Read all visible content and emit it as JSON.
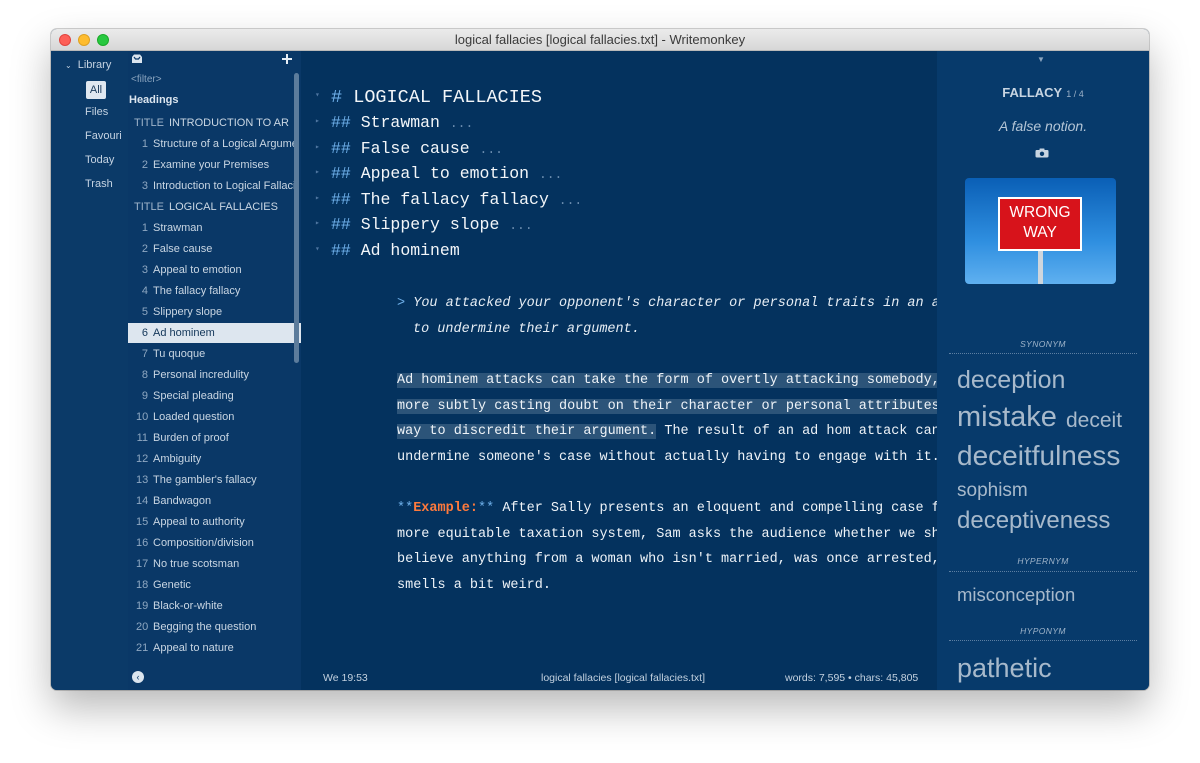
{
  "window": {
    "title": "logical fallacies [logical fallacies.txt] - Writemonkey"
  },
  "library": {
    "header": "Library",
    "items": [
      "All",
      "Files",
      "Favouri",
      "Today",
      "Trash"
    ]
  },
  "navigator": {
    "filter_placeholder": "<filter>",
    "headings_label": "Headings",
    "rows": [
      {
        "num": "TITLE",
        "label": "INTRODUCTION TO AR"
      },
      {
        "num": "1",
        "label": "Structure of a Logical Argume"
      },
      {
        "num": "2",
        "label": "Examine your Premises"
      },
      {
        "num": "3",
        "label": "Introduction to Logical Fallaci"
      },
      {
        "num": "TITLE",
        "label": "LOGICAL FALLACIES"
      },
      {
        "num": "1",
        "label": "Strawman"
      },
      {
        "num": "2",
        "label": "False cause"
      },
      {
        "num": "3",
        "label": "Appeal to emotion"
      },
      {
        "num": "4",
        "label": "The fallacy fallacy"
      },
      {
        "num": "5",
        "label": "Slippery slope"
      },
      {
        "num": "6",
        "label": "Ad hominem"
      },
      {
        "num": "7",
        "label": "Tu quoque"
      },
      {
        "num": "8",
        "label": "Personal incredulity"
      },
      {
        "num": "9",
        "label": "Special pleading"
      },
      {
        "num": "10",
        "label": "Loaded question"
      },
      {
        "num": "11",
        "label": "Burden of proof"
      },
      {
        "num": "12",
        "label": "Ambiguity"
      },
      {
        "num": "13",
        "label": "The gambler's fallacy"
      },
      {
        "num": "14",
        "label": "Bandwagon"
      },
      {
        "num": "15",
        "label": "Appeal to authority"
      },
      {
        "num": "16",
        "label": "Composition/division"
      },
      {
        "num": "17",
        "label": "No true scotsman"
      },
      {
        "num": "18",
        "label": "Genetic"
      },
      {
        "num": "19",
        "label": "Black-or-white"
      },
      {
        "num": "20",
        "label": "Begging the question"
      },
      {
        "num": "21",
        "label": "Appeal to nature"
      }
    ]
  },
  "editor": {
    "h1_hash": "#",
    "h1_text": "LOGICAL FALLACIES",
    "h2_hash": "##",
    "h2_items": [
      "Strawman",
      "False cause",
      "Appeal to emotion",
      "The fallacy fallacy",
      "Slippery slope",
      "Ad hominem"
    ],
    "ellipsis": "...",
    "quote_marker": ">",
    "quote_lines": [
      "You attacked your opponent's character or personal traits in an attempt",
      "to undermine their argument."
    ],
    "para1_highlight": [
      "Ad hominem attacks can take the form of overtly attacking somebody, or",
      "more subtly casting doubt on their character or personal attributes as a",
      "way to discredit their argument."
    ],
    "para1_rest": [
      " The result of an ad hom attack can be to",
      "undermine someone's case without actually having to engage with it."
    ],
    "example_stars": "**",
    "example_label": "Example:",
    "example_lines": [
      " After Sally presents an eloquent and compelling case for a",
      "more equitable taxation system, Sam asks the audience whether we should",
      "believe anything from a woman who isn't married, was once arrested, and",
      "smells a bit weird."
    ]
  },
  "status": {
    "time": "We 19:53",
    "file": "logical fallacies [logical fallacies.txt]",
    "counts": "words: 7,595  •  chars: 45,805"
  },
  "thesaurus": {
    "word": "FALLACY",
    "count": "1 / 4",
    "definition": "A false notion.",
    "sign_text": "WRONG WAY",
    "synonym_label": "SYNONYM",
    "synonyms": [
      "deception",
      "mistake",
      "deceit",
      "deceitfulness",
      "sophism",
      "deceptiveness"
    ],
    "hypernym_label": "HYPERNYM",
    "hypernyms": [
      "misconception"
    ],
    "hyponym_label": "HYPONYM",
    "hyponyms": [
      "pathetic"
    ]
  },
  "colors": {
    "background": "#04325e",
    "accent": "#6fb0ea",
    "example": "#ff7a3c",
    "highlight": "#2c5479"
  }
}
